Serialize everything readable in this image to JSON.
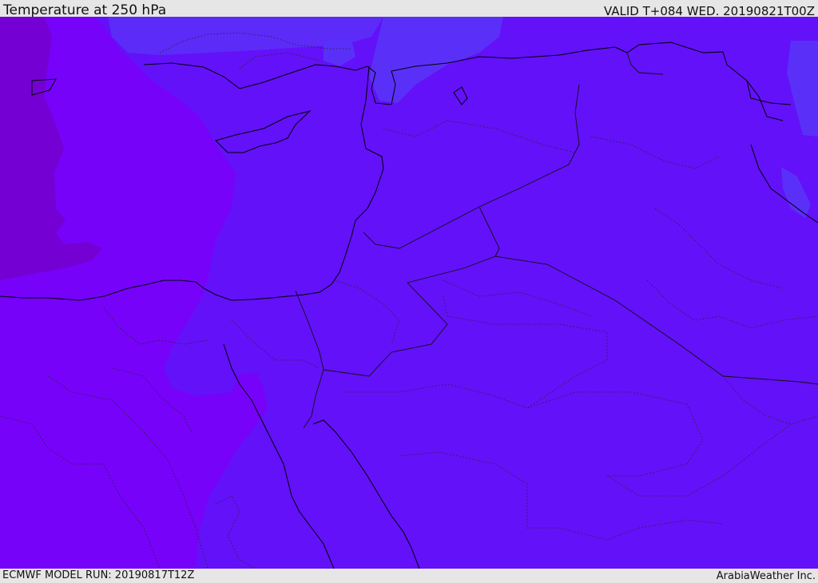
{
  "header": {
    "title": "Temperature at 250 hPa",
    "valid": "VALID T+084 WED. 20190821T00Z"
  },
  "footer": {
    "model_run": "ECMWF MODEL RUN: 20190817T12Z",
    "credit": "ArabiaWeather Inc."
  },
  "map": {
    "field": "temperature",
    "level": "250 hPa",
    "colors": {
      "base": "#6311f8",
      "warm": "#7602f9",
      "warmest": "#7400d3",
      "cool": "#5a30f8",
      "coast": "#000000",
      "border": "#111111"
    }
  }
}
